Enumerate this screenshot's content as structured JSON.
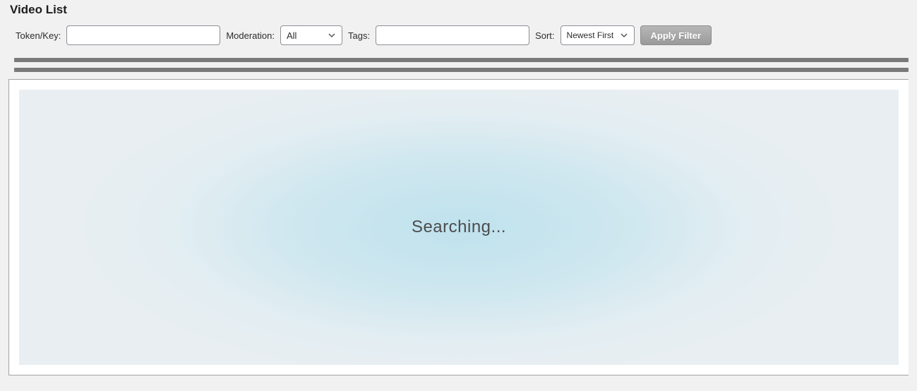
{
  "title": "Video List",
  "filters": {
    "token_label": "Token/Key:",
    "token_value": "",
    "moderation_label": "Moderation:",
    "moderation_selected": "All",
    "moderation_options": [
      "All"
    ],
    "tags_label": "Tags:",
    "tags_value": "",
    "sort_label": "Sort:",
    "sort_selected": "Newest First",
    "sort_options": [
      "Newest First"
    ],
    "apply_label": "Apply Filter"
  },
  "status_text": "Searching..."
}
